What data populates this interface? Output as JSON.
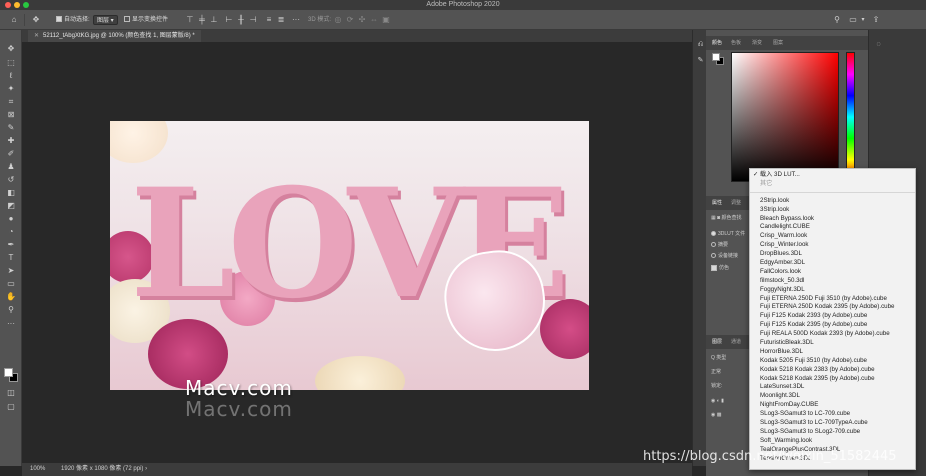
{
  "window": {
    "title": "Adobe Photoshop 2020"
  },
  "options_bar": {
    "home_icon": "home-icon",
    "move_icon": "move-tool-icon",
    "auto_select_label": "自动选择:",
    "auto_select_value": "图层",
    "show_transform_label": "显示变换控件",
    "more_icon": "more-icon",
    "mode_3d_label": "3D 模式:"
  },
  "document_tab": {
    "label": "52112_tAbgXtKG.jpg @ 100% (颜色查找 1, 图层蒙版/8) *"
  },
  "canvas": {
    "watermark": "Macv.com",
    "photo_text": "LOVE"
  },
  "status_bar": {
    "zoom": "100%",
    "doc_info": "1920 像素 x 1080 像素 (72 ppi)"
  },
  "color_panel": {
    "tabs": [
      "颜色",
      "色板",
      "渐变",
      "图案"
    ]
  },
  "properties_panel": {
    "tabs": [
      "属性",
      "调整"
    ],
    "title": "颜色查找",
    "rows": [
      "3DLUT 文件",
      "摘要",
      "设备链接",
      "仿色"
    ]
  },
  "layers_panel": {
    "tabs": [
      "图层",
      "通道"
    ],
    "kind": "Q 类型",
    "blend": "正常",
    "lock": "锁定:"
  },
  "lut_dropdown": {
    "checked_item": "载入 3D LUT...",
    "disabled_item": "其它",
    "items": [
      "2Strip.look",
      "3Strip.look",
      "Bleach Bypass.look",
      "Candlelight.CUBE",
      "Crisp_Warm.look",
      "Crisp_Winter.look",
      "DropBlues.3DL",
      "EdgyAmber.3DL",
      "FallColors.look",
      "filmstock_50.3dl",
      "FoggyNight.3DL",
      "Fuji ETERNA 250D Fuji 3510 (by Adobe).cube",
      "Fuji ETERNA 250D Kodak 2395 (by Adobe).cube",
      "Fuji F125 Kodak 2393 (by Adobe).cube",
      "Fuji F125 Kodak 2395 (by Adobe).cube",
      "Fuji REALA 500D Kodak 2393 (by Adobe).cube",
      "FuturisticBleak.3DL",
      "HorrorBlue.3DL",
      "Kodak 5205 Fuji 3510 (by Adobe).cube",
      "Kodak 5218 Kodak 2383 (by Adobe).cube",
      "Kodak 5218 Kodak 2395 (by Adobe).cube",
      "LateSunset.3DL",
      "Moonlight.3DL",
      "NightFromDay.CUBE",
      "SLog3-SGamut3 to LC-709.cube",
      "SLog3-SGamut3 to LC-709TypeA.cube",
      "SLog3-SGamut3 to SLog2-709.cube",
      "Soft_Warming.look",
      "TealOrangePlusContrast.3DL",
      "TensionGreen.3DL"
    ]
  },
  "overlay": {
    "csdn_watermark": "https://blog.csdn.net/weixin_51582445"
  }
}
